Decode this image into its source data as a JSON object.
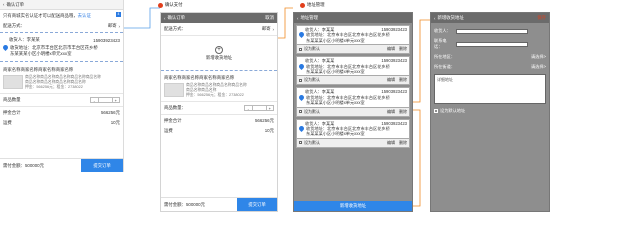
{
  "annotations": {
    "pay_page": "确认支付",
    "address_manage": "地址管理"
  },
  "p1": {
    "notice_prefix": "只有商城实名认证才可以配送商品哦，",
    "notice_link": "去认证",
    "delivery_label": "配送方式：",
    "delivery_value": "邮寄",
    "recipient_label": "收货人：李某某",
    "recipient_phone": "15903923423",
    "address_line1": "收货地址：北京市丰台区北京市丰台区花乡桥",
    "address_line2": "东某某某小区小明楼x单元xxx室",
    "product_title": "商家名称商家名称商家名称商家名称",
    "product_desc1": "商品名称商品名称商品名称商品名称商品名称",
    "product_desc2": "商品名称商品名称商品名称商品名称",
    "product_price": "押金：566256元；租金：2738022",
    "qty_label": "商品数量",
    "deposit_label": "押金合计",
    "deposit_value": "566256元",
    "freight_label": "运费",
    "freight_value": "10元",
    "total_label": "需付金额：500000元",
    "submit_label": "提交订单"
  },
  "p2": {
    "title": "确认订单",
    "header_right": "取消",
    "delivery_label": "配送方式：",
    "delivery_value": "邮寄",
    "add_address": "新增收货地址",
    "product_title": "商家名称商家名称商家名称商家名称",
    "product_desc1": "商品名称商品名称商品名称商品名称",
    "product_desc2": "商品名称商品名称",
    "product_price": "押金：566256元；租金：2738022",
    "qty_label": "商品数量：",
    "deposit_label": "押金合计",
    "deposit_value": "566256元",
    "freight_label": "运费",
    "freight_value": "10元",
    "total_label": "需付金额：500000元",
    "submit_label": "提交订单"
  },
  "p3": {
    "title": "地址管理",
    "cards": [
      {
        "name": "收货人：李某某",
        "phone": "15903923423",
        "addr1": "收货地址：北京市丰台区北京市丰台区花乡桥",
        "addr2": "东某某某小区小明楼x单元xxx室",
        "default": "设为默认",
        "edit": "编辑",
        "delete": "删除"
      },
      {
        "name": "收货人：李某某",
        "phone": "15903923423",
        "addr1": "收货地址：北京市丰台区北京市丰台区花乡桥",
        "addr2": "东某某某小区小明楼x单元xxx室",
        "default": "设为默认",
        "edit": "编辑",
        "delete": "删除"
      },
      {
        "name": "收货人：李某某",
        "phone": "15903923423",
        "addr1": "收货地址：北京市丰台区北京市丰台区花乡桥",
        "addr2": "东某某某小区小明楼x单元xxx室",
        "default": "设为默认",
        "edit": "编辑",
        "delete": "删除"
      },
      {
        "name": "收货人：李某某",
        "phone": "15903923423",
        "addr1": "收货地址：北京市丰台区北京市丰台区花乡桥",
        "addr2": "东某某某小区小明楼x单元xxx室",
        "default": "设为默认",
        "edit": "编辑",
        "delete": "删除"
      }
    ],
    "add_button": "新增收货地址"
  },
  "p4": {
    "title": "新增收货地址",
    "save": "保存",
    "name_label": "收货人：",
    "phone_label": "联系电话：",
    "region_label": "所在地区：",
    "region_select": "请选择>",
    "street_label": "所在街道：",
    "street_select": "请选择>",
    "detail_placeholder": "详细地址",
    "default_label": "设为默认地址"
  },
  "colors": {
    "accent": "#2f86e8",
    "annotation_line": "#f08a24",
    "marker": "#e23f1c",
    "panel_gray": "#8e8e8e"
  }
}
